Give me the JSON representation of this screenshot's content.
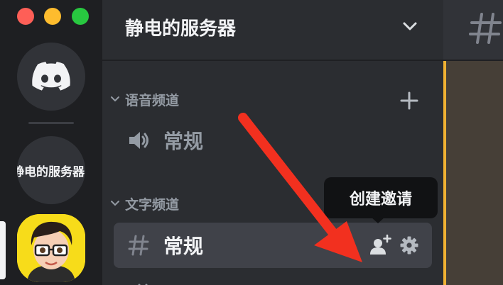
{
  "window": {
    "traffic_lights": [
      {
        "name": "close",
        "color": "#fe5f57"
      },
      {
        "name": "minimize",
        "color": "#febc2e"
      },
      {
        "name": "zoom",
        "color": "#28c840"
      }
    ]
  },
  "rail": {
    "home_icon": "discord-logo-icon",
    "server_pill_label": "静电的服务器",
    "avatar_icon": "cartoon-avatar"
  },
  "sidebar": {
    "server_name": "静电的服务器",
    "header_icon": "chevron-down-icon",
    "categories": [
      {
        "label": "语音频道",
        "add_icon": "plus-icon",
        "channels": [
          {
            "label": "常规",
            "icon": "speaker-icon"
          }
        ]
      },
      {
        "label": "文字频道",
        "channels": [
          {
            "label": "常规",
            "icon": "hash-icon",
            "selected": true,
            "actions": [
              "add-user-icon",
              "gear-icon"
            ]
          }
        ]
      }
    ]
  },
  "tooltip": {
    "text": "创建邀请"
  },
  "chat": {
    "header_icon": "hash-icon"
  },
  "colors": {
    "rail_bg": "#1e1f22",
    "sidebar_bg": "#2b2d31",
    "chat_bg": "#313338",
    "selected_channel_bg": "#404249",
    "tooltip_bg": "#111214",
    "annotation_arrow": "#f2301f",
    "highlight_border": "#f0b132"
  }
}
